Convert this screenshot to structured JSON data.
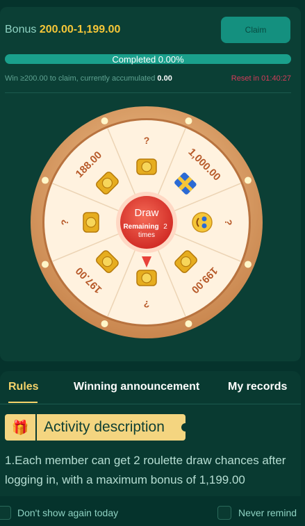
{
  "bonus": {
    "label": "Bonus",
    "range": "200.00-1,199.00",
    "claim_label": "Claim"
  },
  "progress": {
    "text": "Completed 0.00%",
    "percent": 0
  },
  "claim_hint": {
    "prefix": "Win ≥200.00 to claim, currently accumulated",
    "amount": "0.00"
  },
  "reset": {
    "text": "Reset in 01:40:27"
  },
  "wheel": {
    "draw_label": "Draw",
    "remaining_label": "Remaining",
    "remaining_count": "2",
    "times_label": "times",
    "segments": [
      {
        "label": "?",
        "icon": "gold-coins-icon"
      },
      {
        "label": "1,000.00",
        "icon": "gift-box-icon"
      },
      {
        "label": "?",
        "icon": "smiling-face-icon"
      },
      {
        "label": "199.00",
        "icon": "gold-coins-icon"
      },
      {
        "label": "?",
        "icon": "gold-coins-icon"
      },
      {
        "label": "197.00",
        "icon": "gold-coins-icon"
      },
      {
        "label": "?",
        "icon": "gold-coins-icon"
      },
      {
        "label": "188.00",
        "icon": "gold-coins-icon"
      }
    ]
  },
  "tabs": [
    {
      "label": "Rules",
      "active": true
    },
    {
      "label": "Winning announcement",
      "active": false
    },
    {
      "label": "My records",
      "active": false
    }
  ],
  "activity": {
    "title": "Activity description",
    "description": "1.Each member can get 2 roulette draw chances after logging in, with a maximum bonus of 1,199.00"
  },
  "footer": {
    "dont_show_label": "Don't show again today",
    "never_remind_label": "Never remind"
  },
  "colors": {
    "accent_gold": "#f5c638",
    "teal": "#14907f",
    "reset_red": "#d43c5a",
    "draw_red": "#e8413a"
  }
}
